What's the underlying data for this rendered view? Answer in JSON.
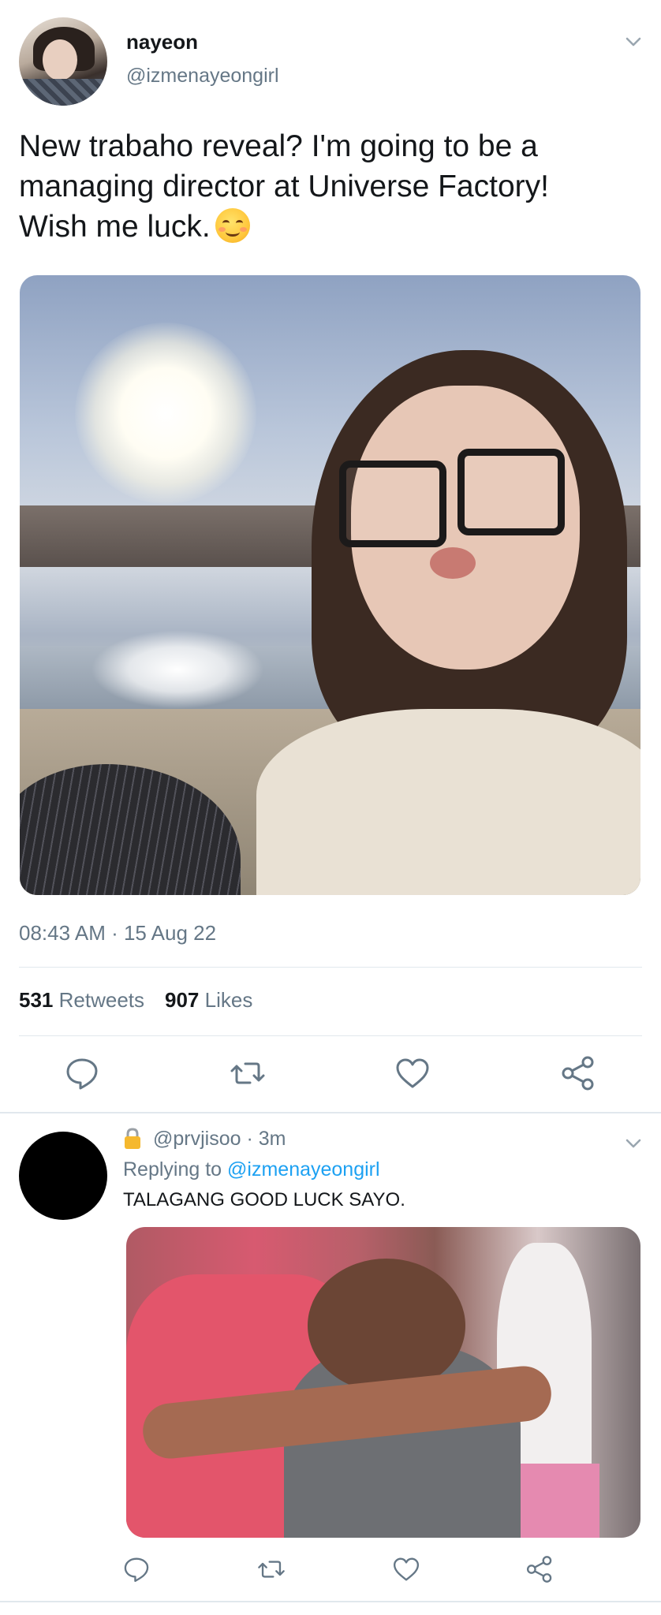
{
  "tweet": {
    "display_name": "nayeon",
    "handle": "@izmenayeongirl",
    "text": "New trabaho reveal? I'm going to be a managing director at Universe Factory! Wish me luck.",
    "timestamp": "08:43 AM · 15 Aug 22",
    "stats": {
      "retweets_count": "531",
      "retweets_label": "Retweets",
      "likes_count": "907",
      "likes_label": "Likes"
    }
  },
  "reply": {
    "handle_time": "@prvjisoo · 3m",
    "replying_prefix": "Replying to",
    "replying_to": "@izmenayeongirl",
    "text": "TALAGANG GOOD LUCK SAYO."
  },
  "colors": {
    "text_primary": "#14171a",
    "text_secondary": "#657786",
    "link": "#1da1f2",
    "divider": "#e1e8ed"
  },
  "icons": [
    "chevron-down-icon",
    "reply-icon",
    "retweet-icon",
    "like-icon",
    "share-icon",
    "lock-icon",
    "smiling-face-emoji"
  ]
}
